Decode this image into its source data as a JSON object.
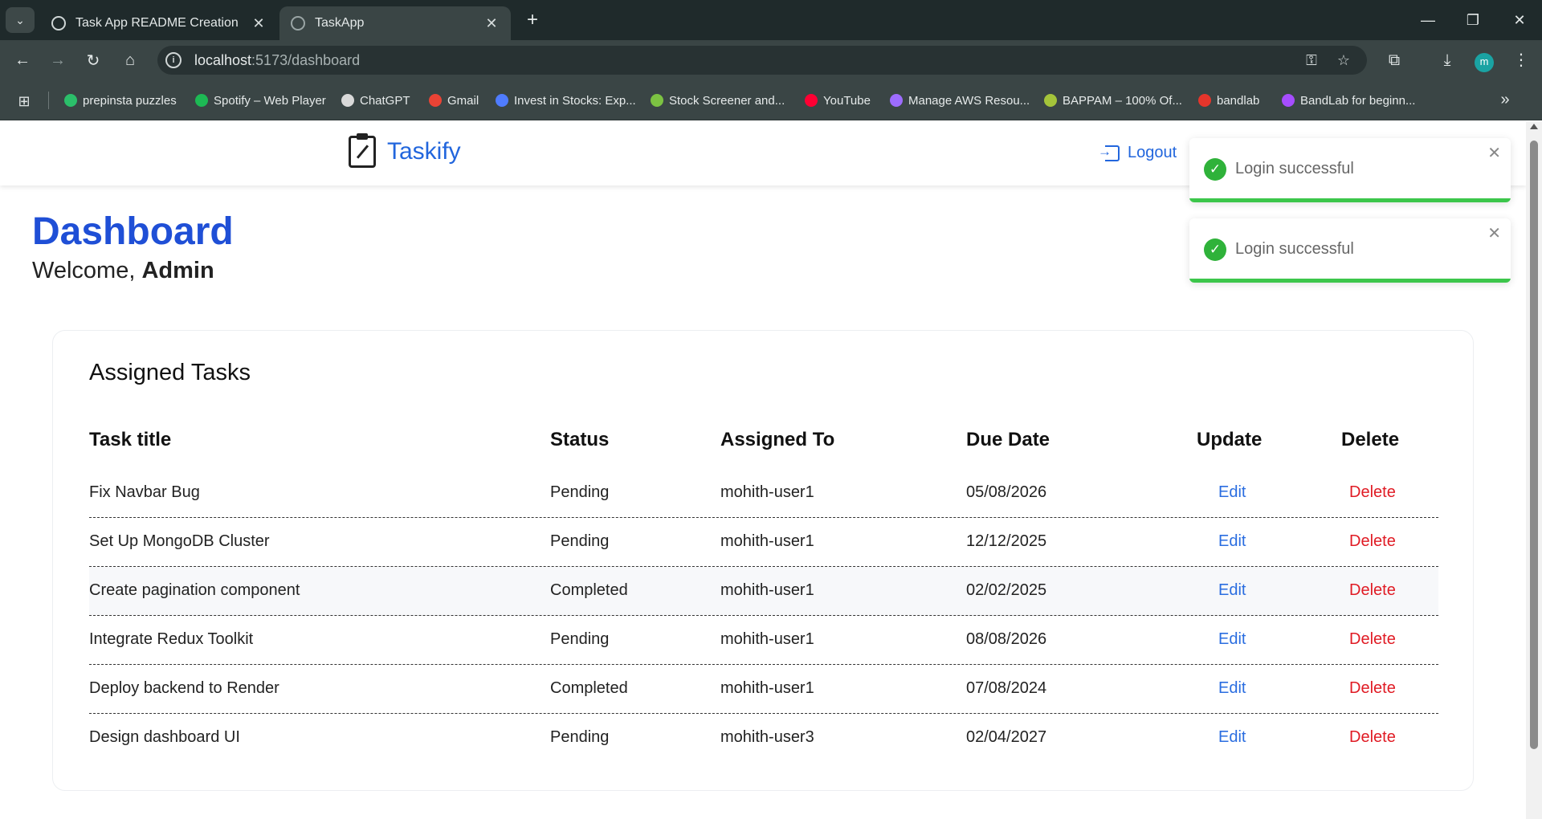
{
  "browser": {
    "tabs": [
      {
        "title": "Task App README Creation",
        "close": "✕"
      },
      {
        "title": "TaskApp",
        "close": "✕"
      }
    ],
    "new_tab": "+",
    "url_host": "localhost",
    "url_path": ":5173/dashboard",
    "profile_initial": "m",
    "bookmarks": [
      {
        "label": "prepinsta puzzles",
        "color": "#2bbf6a"
      },
      {
        "label": "Spotify – Web Player",
        "color": "#1db954"
      },
      {
        "label": "ChatGPT",
        "color": "#d9d9d9"
      },
      {
        "label": "Gmail",
        "color": "#ea4335"
      },
      {
        "label": "Invest in Stocks: Exp...",
        "color": "#4f7cff"
      },
      {
        "label": "Stock Screener and...",
        "color": "#7cc242"
      },
      {
        "label": "YouTube",
        "color": "#ff0033"
      },
      {
        "label": "Manage AWS Resou...",
        "color": "#9d6cff"
      },
      {
        "label": "BAPPAM – 100% Of...",
        "color": "#a4c43a"
      },
      {
        "label": "bandlab",
        "color": "#e5352b"
      },
      {
        "label": "BandLab for beginn...",
        "color": "#a64dff"
      }
    ]
  },
  "app": {
    "brand": "Taskify",
    "logout": "Logout",
    "title": "Dashboard",
    "welcome_prefix": "Welcome, ",
    "user": "Admin"
  },
  "card": {
    "title": "Assigned Tasks",
    "columns": [
      "Task title",
      "Status",
      "Assigned To",
      "Due Date",
      "Update",
      "Delete"
    ],
    "rows": [
      {
        "title": "Fix Navbar Bug",
        "status": "Pending",
        "assigned": "mohith-user1",
        "due": "05/08/2026",
        "edit": "Edit",
        "delete": "Delete"
      },
      {
        "title": "Set Up MongoDB Cluster",
        "status": "Pending",
        "assigned": "mohith-user1",
        "due": "12/12/2025",
        "edit": "Edit",
        "delete": "Delete"
      },
      {
        "title": "Create pagination component",
        "status": "Completed",
        "assigned": "mohith-user1",
        "due": "02/02/2025",
        "edit": "Edit",
        "delete": "Delete"
      },
      {
        "title": "Integrate Redux Toolkit",
        "status": "Pending",
        "assigned": "mohith-user1",
        "due": "08/08/2026",
        "edit": "Edit",
        "delete": "Delete"
      },
      {
        "title": "Deploy backend to Render",
        "status": "Completed",
        "assigned": "mohith-user1",
        "due": "07/08/2024",
        "edit": "Edit",
        "delete": "Delete"
      },
      {
        "title": "Design dashboard UI",
        "status": "Pending",
        "assigned": "mohith-user3",
        "due": "02/04/2027",
        "edit": "Edit",
        "delete": "Delete"
      }
    ]
  },
  "toasts": [
    {
      "message": "Login successful",
      "close": "✕"
    },
    {
      "message": "Login successful",
      "close": "✕"
    }
  ],
  "colors": {
    "accent": "#2266dd",
    "title": "#1f4fd6",
    "edit": "#2a6de0",
    "delete": "#e01b24",
    "success": "#2fb23a"
  }
}
